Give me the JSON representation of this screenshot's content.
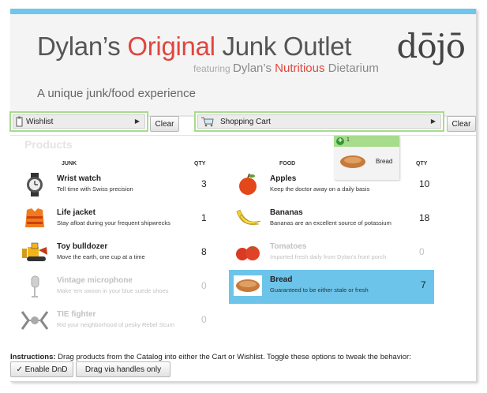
{
  "header": {
    "title_part1": "Dylan’s ",
    "title_part2": "Original",
    "title_part3": " Junk Outlet",
    "subtitle_featuring": "featuring ",
    "subtitle_part1": "Dylan’s ",
    "subtitle_part2": "Nutritious",
    "subtitle_part3": " Dietarium",
    "tagline": "A unique junk/food experience",
    "logo": "dōjō"
  },
  "wishlist": {
    "label": "Wishlist",
    "clear": "Clear"
  },
  "cart": {
    "label": "Shopping Cart",
    "clear": "Clear"
  },
  "products_title": "Products",
  "junk": {
    "heading": "JUNK",
    "qty_heading": "QTY",
    "items": [
      {
        "name": "Wrist watch",
        "desc": "Tell time with Swiss precision",
        "qty": "3"
      },
      {
        "name": "Life jacket",
        "desc": "Stay afloat during your frequent shipwrecks",
        "qty": "1"
      },
      {
        "name": "Toy bulldozer",
        "desc": "Move the earth, one cup at a time",
        "qty": "8"
      },
      {
        "name": "Vintage microphone",
        "desc": "Make 'em swoon in your blue suede shoes",
        "qty": "0"
      },
      {
        "name": "TIE fighter",
        "desc": "Rid your neighborhood of pesky Rebel Scum",
        "qty": "0"
      }
    ]
  },
  "food": {
    "heading": "FOOD",
    "qty_heading": "QTY",
    "items": [
      {
        "name": "Apples",
        "desc": "Keep the doctor away on a daily basis",
        "qty": "10"
      },
      {
        "name": "Bananas",
        "desc": "Bananas are an excellent source of potassium",
        "qty": "18"
      },
      {
        "name": "Tomatoes",
        "desc": "Imported fresh daily from Dylan's front porch",
        "qty": "0"
      },
      {
        "name": "Bread",
        "desc": "Guaranteed to be either stale or fresh",
        "qty": "7"
      }
    ]
  },
  "drag_avatar": {
    "count": "1",
    "name": "Bread"
  },
  "instructions": {
    "label": "Instructions:",
    "text": " Drag products from the Catalog into either the Cart or Wishlist. Toggle these options to tweak the behavior:",
    "btn_dnd": "✓ Enable DnD",
    "btn_handles": "Drag via handles only"
  },
  "colors": {
    "accent_blue": "#6cc4ea",
    "drop_green": "#a6dc8c",
    "title_red": "#e0463d"
  }
}
